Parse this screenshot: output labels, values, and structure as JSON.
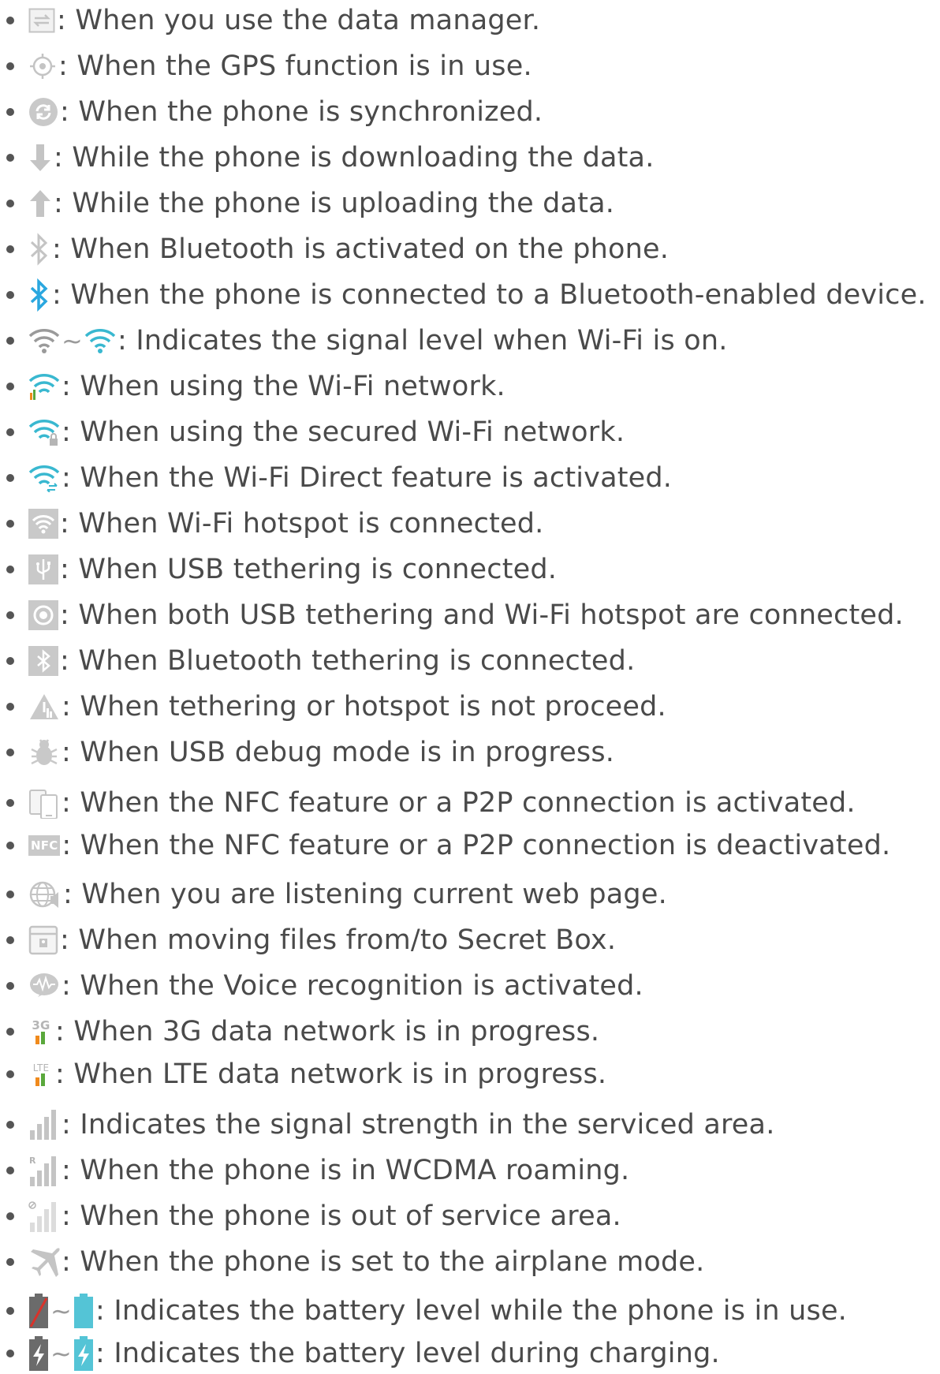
{
  "items": [
    {
      "icon": "data-manager-icon",
      "text": ": When you use the data manager."
    },
    {
      "icon": "gps-icon",
      "text": ": When the GPS function is in use."
    },
    {
      "icon": "sync-icon",
      "text": ": When the phone is synchronized."
    },
    {
      "icon": "download-arrow-icon",
      "text": ": While the phone is downloading the data."
    },
    {
      "icon": "upload-arrow-icon",
      "text": ": While the phone is uploading the data."
    },
    {
      "icon": "bluetooth-grey-icon",
      "text": ": When Bluetooth is activated on the phone."
    },
    {
      "icon": "bluetooth-blue-icon",
      "text": ": When the phone is connected to a Bluetooth-enabled device."
    },
    {
      "icon": "wifi-signal-range-icon",
      "text": ": Indicates the signal level when Wi-Fi is on."
    },
    {
      "icon": "wifi-in-use-icon",
      "text": ": When using the Wi-Fi network."
    },
    {
      "icon": "wifi-secured-icon",
      "text": ": When using the secured Wi-Fi network."
    },
    {
      "icon": "wifi-direct-icon",
      "text": ": When the Wi-Fi Direct feature is activated."
    },
    {
      "icon": "wifi-hotspot-icon",
      "text": ": When Wi-Fi hotspot is connected."
    },
    {
      "icon": "usb-tethering-icon",
      "text": ": When USB tethering is connected."
    },
    {
      "icon": "usb-and-hotspot-icon",
      "text": ": When both USB tethering and Wi-Fi hotspot are connected."
    },
    {
      "icon": "bluetooth-tethering-icon",
      "text": ": When Bluetooth tethering is connected."
    },
    {
      "icon": "tethering-warning-icon",
      "text": ": When tethering or hotspot is not proceed."
    },
    {
      "icon": "usb-debug-bug-icon",
      "text": ": When USB debug mode is in progress."
    },
    {
      "icon": "nfc-p2p-active-icon",
      "text": ": When the NFC feature or a P2P connection is activated."
    },
    {
      "icon": "nfc-inactive-icon",
      "text": ": When the NFC feature or a P2P connection is deactivated."
    },
    {
      "icon": "web-listening-icon",
      "text": ": When you are listening current web page."
    },
    {
      "icon": "secret-box-icon",
      "text": ": When moving files from/to Secret Box."
    },
    {
      "icon": "voice-recognition-icon",
      "text": ": When the Voice recognition is activated."
    },
    {
      "icon": "3g-data-icon",
      "text": ": When 3G data network is in progress."
    },
    {
      "icon": "lte-data-icon",
      "text": ": When LTE data network is in progress."
    },
    {
      "icon": "signal-strength-icon",
      "text": ": Indicates the signal strength in the serviced area."
    },
    {
      "icon": "roaming-signal-icon",
      "text": ": When the phone is in WCDMA roaming."
    },
    {
      "icon": "no-service-signal-icon",
      "text": ": When the phone is out of service area."
    },
    {
      "icon": "airplane-icon",
      "text": ": When the phone is set to the airplane mode."
    },
    {
      "icon": "battery-level-range-icon",
      "text": ": Indicates the battery level while the phone is in use."
    },
    {
      "icon": "battery-charging-range-icon",
      "text": ": Indicates the battery level during charging."
    }
  ],
  "icon_labels": {
    "3g": "3G",
    "lte": "LTE",
    "nfc": "NFC",
    "roaming": "R",
    "tilde": "~"
  },
  "colors": {
    "text": "#4a4a4a",
    "icon_grey": "#c4c4c4",
    "bluetooth_blue": "#2aa7df",
    "wifi_teal": "#39b8d0",
    "battery_teal": "#54c4d6",
    "data_orange": "#f08a1c",
    "data_green": "#5aa83c",
    "battery_red": "#d9322a"
  }
}
